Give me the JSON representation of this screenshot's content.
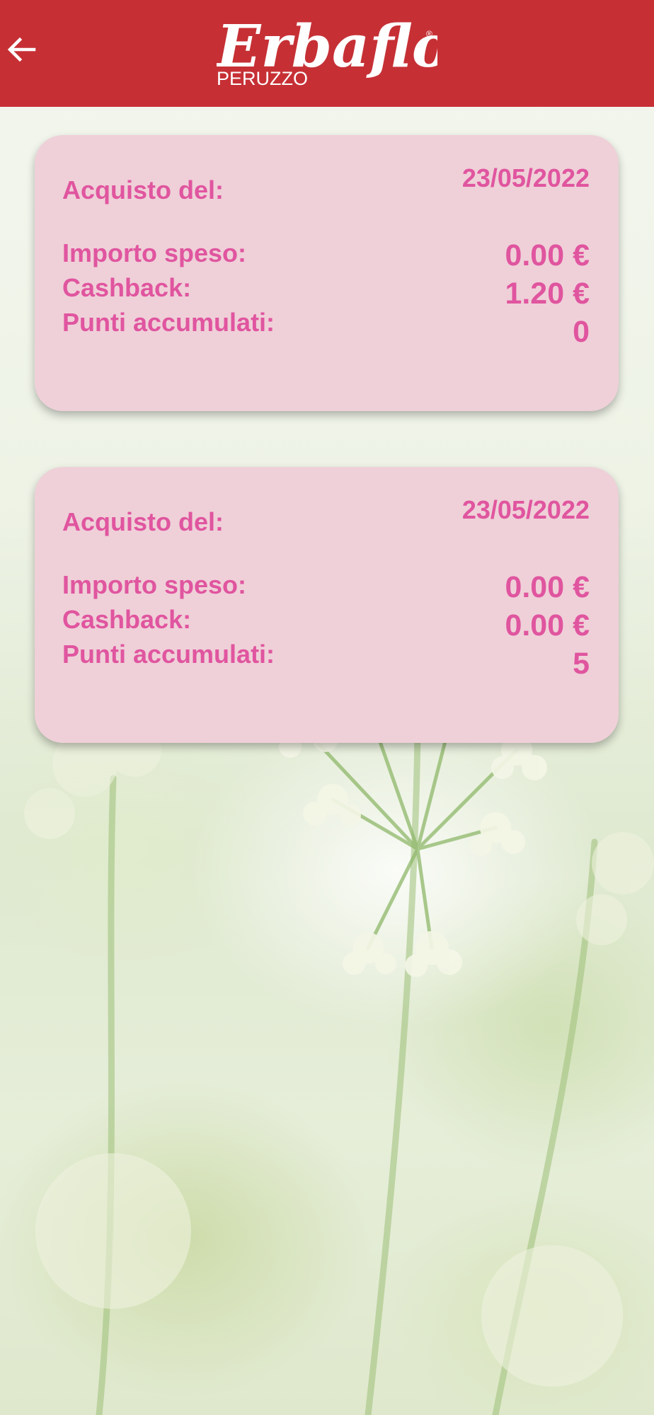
{
  "header": {
    "back_icon": "arrow-left-icon",
    "logo": {
      "brand": "Erbaflor",
      "subtitle": "PERUZZO",
      "registered_mark": "®"
    },
    "colors": {
      "header_bg": "#c63035",
      "header_fg": "#ffffff"
    }
  },
  "colors": {
    "card_bg": "#efd0d8",
    "card_text": "#e0559f"
  },
  "purchases": [
    {
      "date_label": "Acquisto del:",
      "date": "23/05/2022",
      "amount_label": "Importo speso:",
      "amount": "0.00 €",
      "cashback_label": "Cashback:",
      "cashback": "1.20 €",
      "points_label": "Punti accumulati:",
      "points": "0"
    },
    {
      "date_label": "Acquisto del:",
      "date": "23/05/2022",
      "amount_label": "Importo speso:",
      "amount": "0.00 €",
      "cashback_label": "Cashback:",
      "cashback": "0.00 €",
      "points_label": "Punti accumulati:",
      "points": "5"
    }
  ]
}
